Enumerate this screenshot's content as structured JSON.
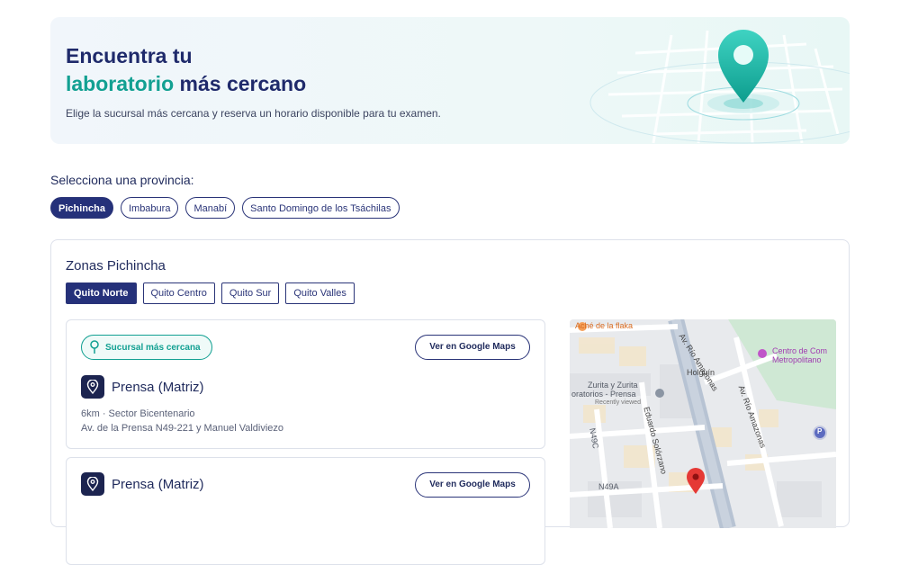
{
  "hero": {
    "title_line1": "Encuentra tu",
    "title_accent": "laboratorio",
    "title_rest": " más cercano",
    "description": "Elige la sucursal más cercana y reserva un horario disponible para tu examen."
  },
  "province": {
    "label": "Selecciona una provincia:",
    "options": [
      "Pichincha",
      "Imbabura",
      "Manabí",
      "Santo Domingo de los Tsáchilas"
    ],
    "selected": "Pichincha"
  },
  "zones": {
    "title": "Zonas Pichincha",
    "tabs": [
      "Quito Norte",
      "Quito Centro",
      "Quito Sur",
      "Quito Valles"
    ],
    "selected": "Quito Norte"
  },
  "branches": [
    {
      "badge": "Sucursal más cercana",
      "maps_label": "Ver en Google Maps",
      "name": "Prensa (Matriz)",
      "distance_line": "6km · Sector Bicentenario",
      "address": "Av. de la Prensa N49-221 y Manuel Valdiviezo"
    },
    {
      "maps_label": "Ver en Google Maps",
      "name": "Prensa (Matriz)"
    }
  ],
  "map": {
    "labels": {
      "ache": "Aché de la flaka",
      "rio_amazonas_top": "Av. Río Amazonas",
      "rio_amazonas_right": "Av. Río Amazonas",
      "centro": "Centro de Com",
      "metropolitano": "Metropolitano",
      "holguin": "Holguín",
      "zurita1": "Zurita y Zurita",
      "zurita2": "oratorios - Prensa",
      "recently": "Recently viewed",
      "eduardo": "Eduardo Solórzano",
      "n49c": "N49C",
      "n49a": "N49A",
      "parking": "P"
    }
  },
  "colors": {
    "primary": "#25317a",
    "accent": "#12a092",
    "map_pin": "#e53935"
  }
}
